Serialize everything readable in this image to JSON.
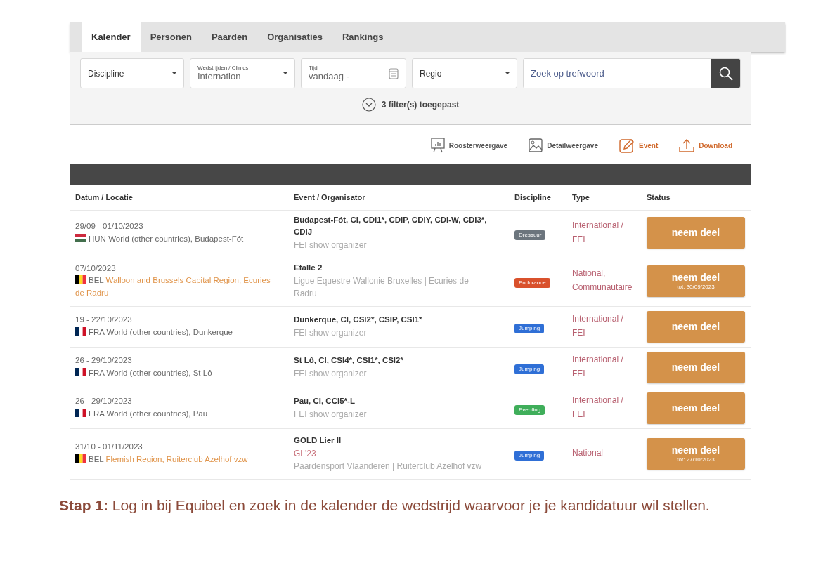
{
  "nav_tabs": [
    {
      "label": "Kalender",
      "selected": true
    },
    {
      "label": "Personen",
      "selected": false
    },
    {
      "label": "Paarden",
      "selected": false
    },
    {
      "label": "Organisaties",
      "selected": false
    },
    {
      "label": "Rankings",
      "selected": false
    }
  ],
  "filters": [
    {
      "kind": "select",
      "label": "Discipline"
    },
    {
      "kind": "select",
      "label": "Wedstrijden / Clinics",
      "value": "Internation"
    },
    {
      "kind": "date",
      "label": "Tijd",
      "value": "vandaag -"
    },
    {
      "kind": "select",
      "label": "Regio"
    }
  ],
  "search": {
    "placeholder": "Zoek op trefwoord"
  },
  "filter_summary": "3 filter(s) toegepast",
  "toolbar": [
    {
      "kind": "grid",
      "label": "Roosterweergave",
      "accent": false
    },
    {
      "kind": "detail",
      "label": "Detailweergave",
      "accent": false
    },
    {
      "kind": "edit",
      "label": "Event",
      "accent": true
    },
    {
      "kind": "download",
      "label": "Download",
      "accent": true
    }
  ],
  "table": {
    "columns": [
      "Datum / Locatie",
      "Event / Organisator",
      "Discipline",
      "Type",
      "Status"
    ],
    "rows": [
      {
        "date": "29/09 - 01/10/2023",
        "flag": {
          "kind": "hungary"
        },
        "country": "HUN",
        "location": "World (other countries), Budapest-Fót",
        "location_linked": false,
        "event": "Budapest-Fót, CI, CDI1*, CDIP, CDIY, CDI-W, CDI3*, CDIJ",
        "organizer": "FEI show organizer",
        "discipline": {
          "label": "Dressuur",
          "color": "#6c757d"
        },
        "type": "International / FEI",
        "action": "neem deel"
      },
      {
        "date": "07/10/2023",
        "flag": {
          "kind": "belgium"
        },
        "country": "BEL",
        "location": "Walloon and Brussels Capital Region, Ecuries de Radru",
        "location_linked": true,
        "event": "Etalle 2",
        "organizer": "Ligue Equestre Wallonie Bruxelles | Ecuries de Radru",
        "discipline": {
          "label": "Endurance",
          "color": "#d9512c"
        },
        "type": "National, Communautaire",
        "action": "neem deel",
        "deadline": "tot: 30/09/2023"
      },
      {
        "date": "19 - 22/10/2023",
        "flag": {
          "kind": "france"
        },
        "country": "FRA",
        "location": "World (other countries), Dunkerque",
        "location_linked": false,
        "event": "Dunkerque, CI, CSI2*, CSIP, CSI1*",
        "organizer": "FEI show organizer",
        "discipline": {
          "label": "Jumping",
          "color": "#2f6fd6"
        },
        "type": "International / FEI",
        "action": "neem deel"
      },
      {
        "date": "26 - 29/10/2023",
        "flag": {
          "kind": "france"
        },
        "country": "FRA",
        "location": "World (other countries), St Lô",
        "location_linked": false,
        "event": "St Lô, CI, CSI4*, CSI1*, CSI2*",
        "organizer": "FEI show organizer",
        "discipline": {
          "label": "Jumping",
          "color": "#2f6fd6"
        },
        "type": "International / FEI",
        "action": "neem deel"
      },
      {
        "date": "26 - 29/10/2023",
        "flag": {
          "kind": "france"
        },
        "country": "FRA",
        "location": "World (other countries), Pau",
        "location_linked": false,
        "event": "Pau, CI, CCI5*-L",
        "organizer": "FEI show organizer",
        "discipline": {
          "label": "Eventing",
          "color": "#3fae5a"
        },
        "type": "International / FEI",
        "action": "neem deel"
      },
      {
        "date": "31/10 - 01/11/2023",
        "flag": {
          "kind": "belgium"
        },
        "country": "BEL",
        "location": "Flemish Region, Ruiterclub Azelhof vzw",
        "location_linked": true,
        "event": "GOLD Lier II",
        "code": "GL'23",
        "organizer": "Paardensport Vlaanderen | Ruiterclub Azelhof vzw",
        "discipline": {
          "label": "Jumping",
          "color": "#2f6fd6"
        },
        "type": "National",
        "action": "neem deel",
        "deadline": "tot: 27/10/2023"
      }
    ]
  },
  "caption": {
    "step": "Stap 1:",
    "text": "Log in bij Equibel en zoek in de kalender de wedstrijd waarvoor je je kandidatuur wil stellen."
  }
}
